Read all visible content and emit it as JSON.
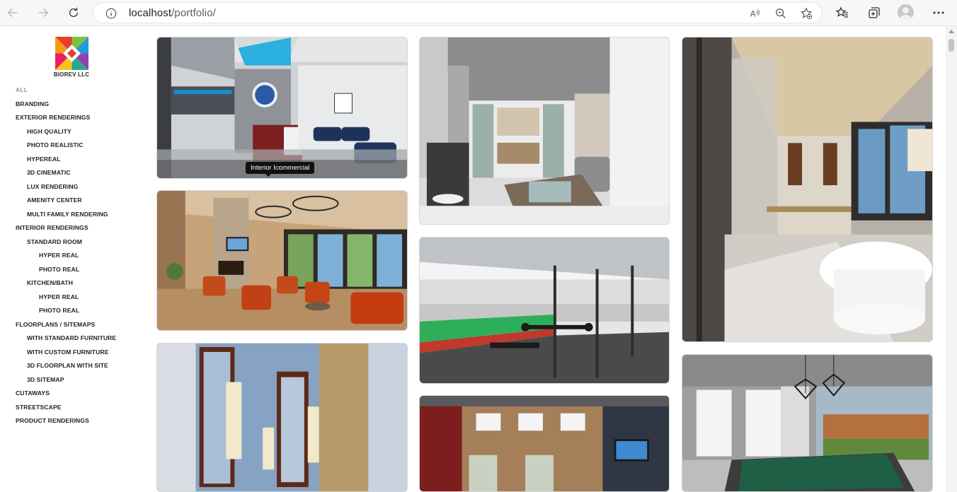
{
  "browser": {
    "url_host": "localhost",
    "url_path": "/portfolio/",
    "icons": [
      "back-icon",
      "forward-icon",
      "refresh-icon",
      "info-icon",
      "read-aloud-icon",
      "zoom-icon",
      "favorite-add-icon",
      "favorites-icon",
      "collections-icon",
      "profile-icon",
      "more-icon"
    ]
  },
  "brand": {
    "name": "BIOREV LLC",
    "colors": [
      "#e63c2d",
      "#f39c12",
      "#7cc242",
      "#1f9bd7",
      "#8e44ad",
      "#e91e63"
    ]
  },
  "menu": {
    "items": [
      {
        "label": "ALL",
        "active": true
      },
      {
        "label": "BRANDING"
      },
      {
        "label": "EXTERIOR RENDERINGS"
      },
      {
        "label": "HIGH QUALITY"
      },
      {
        "label": "PHOTO REALISTIC"
      },
      {
        "label": "HYPEREAL"
      },
      {
        "label": "3D CINEMATIC"
      },
      {
        "label": "LUX RENDERING"
      },
      {
        "label": "AMENITY CENTER"
      },
      {
        "label": "MULTI FAMILY RENDERING"
      },
      {
        "label": "INTERIOR RENDERINGS"
      },
      {
        "label": "STANDARD ROOM"
      },
      {
        "label": "HYPER REAL"
      },
      {
        "label": "PHOTO REAL"
      },
      {
        "label": "KITCHEN/BATH"
      },
      {
        "label": "HYPER REAL"
      },
      {
        "label": "PHOTO REAL"
      },
      {
        "label": "FLOORPLANS / SITEMAPS"
      },
      {
        "label": "WITH STANDARD FURNITURE"
      },
      {
        "label": "WITH CUSTOM FURNITURE"
      },
      {
        "label": "3D FLOORPLAN WITH SITE"
      },
      {
        "label": "3D SITEMAP"
      },
      {
        "label": "CUTAWAYS"
      },
      {
        "label": "STREETSCAPE"
      },
      {
        "label": "PRODUCT RENDERINGS"
      }
    ]
  },
  "gallery": {
    "tooltip": "Interior Icommercial"
  }
}
